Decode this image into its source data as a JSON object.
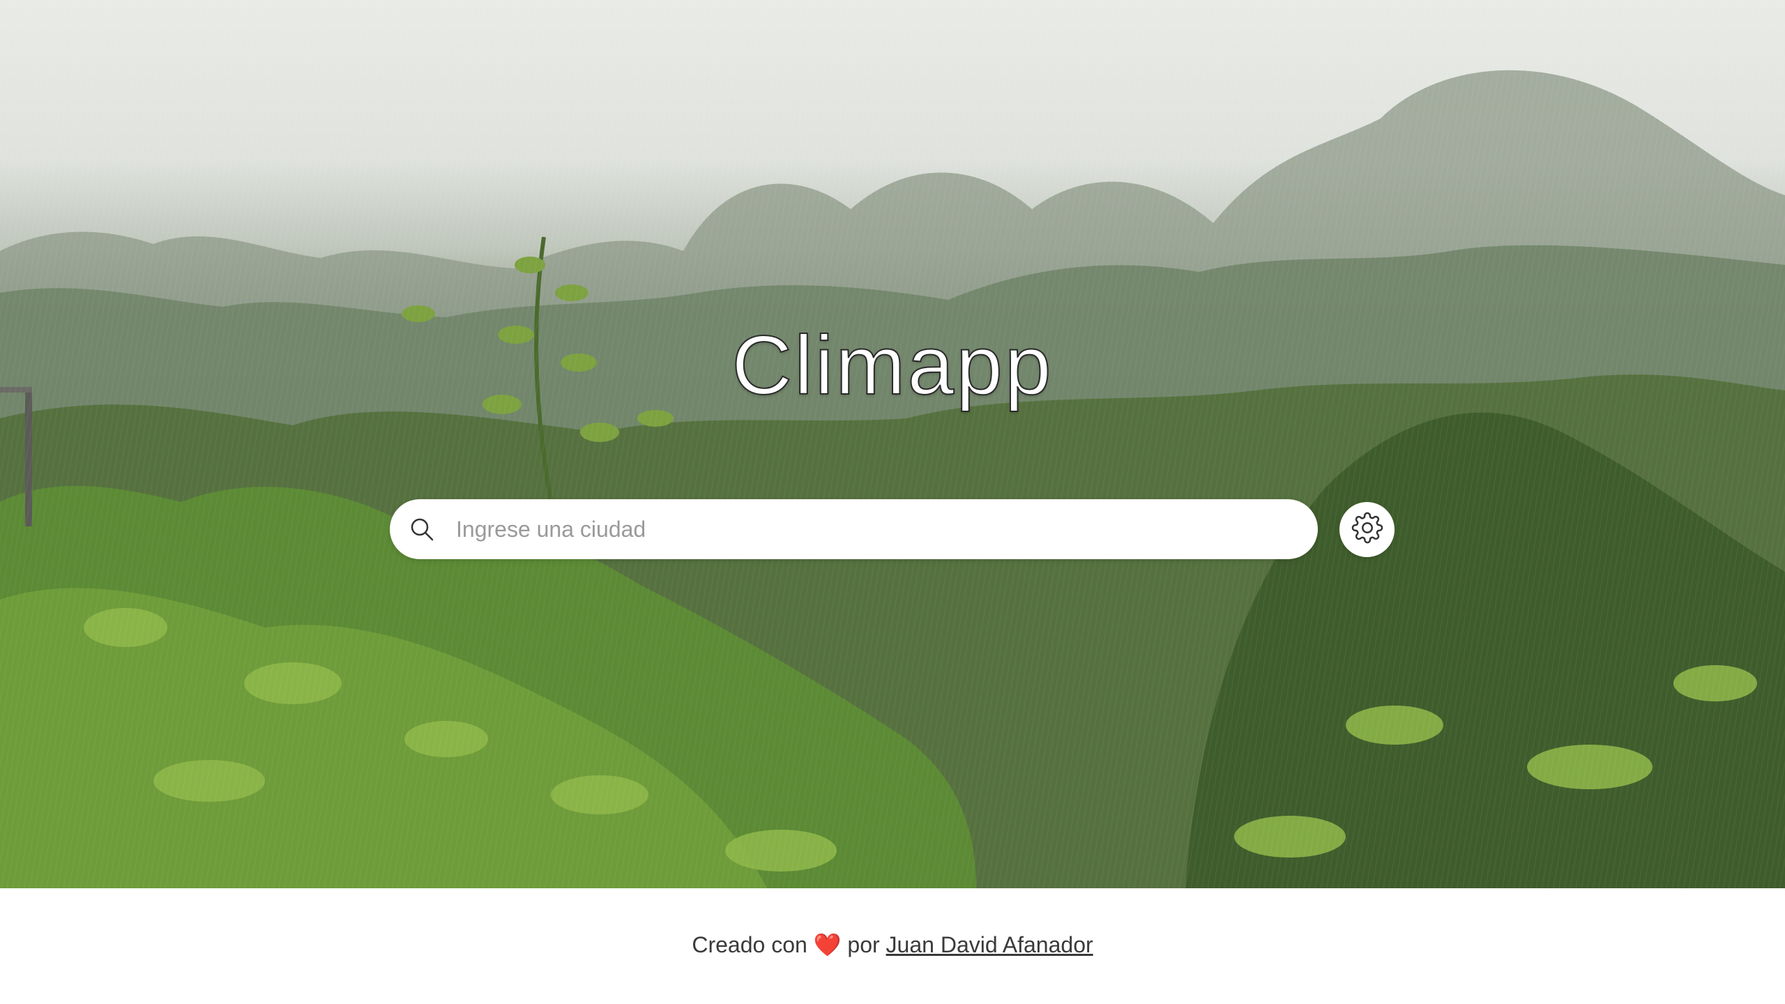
{
  "app": {
    "title": "Climapp"
  },
  "search": {
    "placeholder": "Ingrese una ciudad",
    "value": "",
    "icon": "search-icon"
  },
  "settings": {
    "icon": "gear-icon"
  },
  "footer": {
    "prefix": "Creado con",
    "heart": "❤️",
    "middle": "por",
    "author_link": "Juan David Afanador"
  },
  "colors": {
    "title_fill": "#ffffff",
    "title_stroke": "#2a2a2a",
    "footer_text": "#3a3a3a",
    "heart": "#e0245e"
  }
}
